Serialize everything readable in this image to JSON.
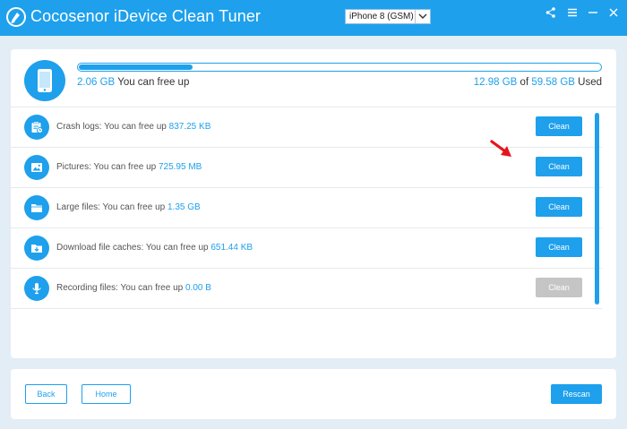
{
  "app": {
    "title": "Cocosenor iDevice Clean Tuner",
    "device_selected": "iPhone 8 (GSM)"
  },
  "colors": {
    "accent": "#1ea0ec",
    "disabled": "#c5c5c5",
    "arrow": "#e8141b"
  },
  "storage": {
    "free_amount": "2.06 GB",
    "free_text": "You can free up",
    "used_amount": "12.98 GB",
    "of_text": "of",
    "total_amount": "59.58 GB",
    "used_text": "Used",
    "used_fraction": 0.218
  },
  "items": [
    {
      "icon": "crash-logs-icon",
      "label": "Crash logs: You can free up",
      "size": "837.25 KB",
      "button": "Clean",
      "enabled": true
    },
    {
      "icon": "pictures-icon",
      "label": "Pictures: You can free up",
      "size": "725.95 MB",
      "button": "Clean",
      "enabled": true
    },
    {
      "icon": "folder-icon",
      "label": "Large files: You can free up",
      "size": "1.35 GB",
      "button": "Clean",
      "enabled": true
    },
    {
      "icon": "download-icon",
      "label": "Download file caches: You can free up",
      "size": "651.44 KB",
      "button": "Clean",
      "enabled": true
    },
    {
      "icon": "microphone-icon",
      "label": "Recording files: You can free up",
      "size": "0.00 B",
      "button": "Clean",
      "enabled": false
    }
  ],
  "footer": {
    "back": "Back",
    "home": "Home",
    "rescan": "Rescan"
  }
}
